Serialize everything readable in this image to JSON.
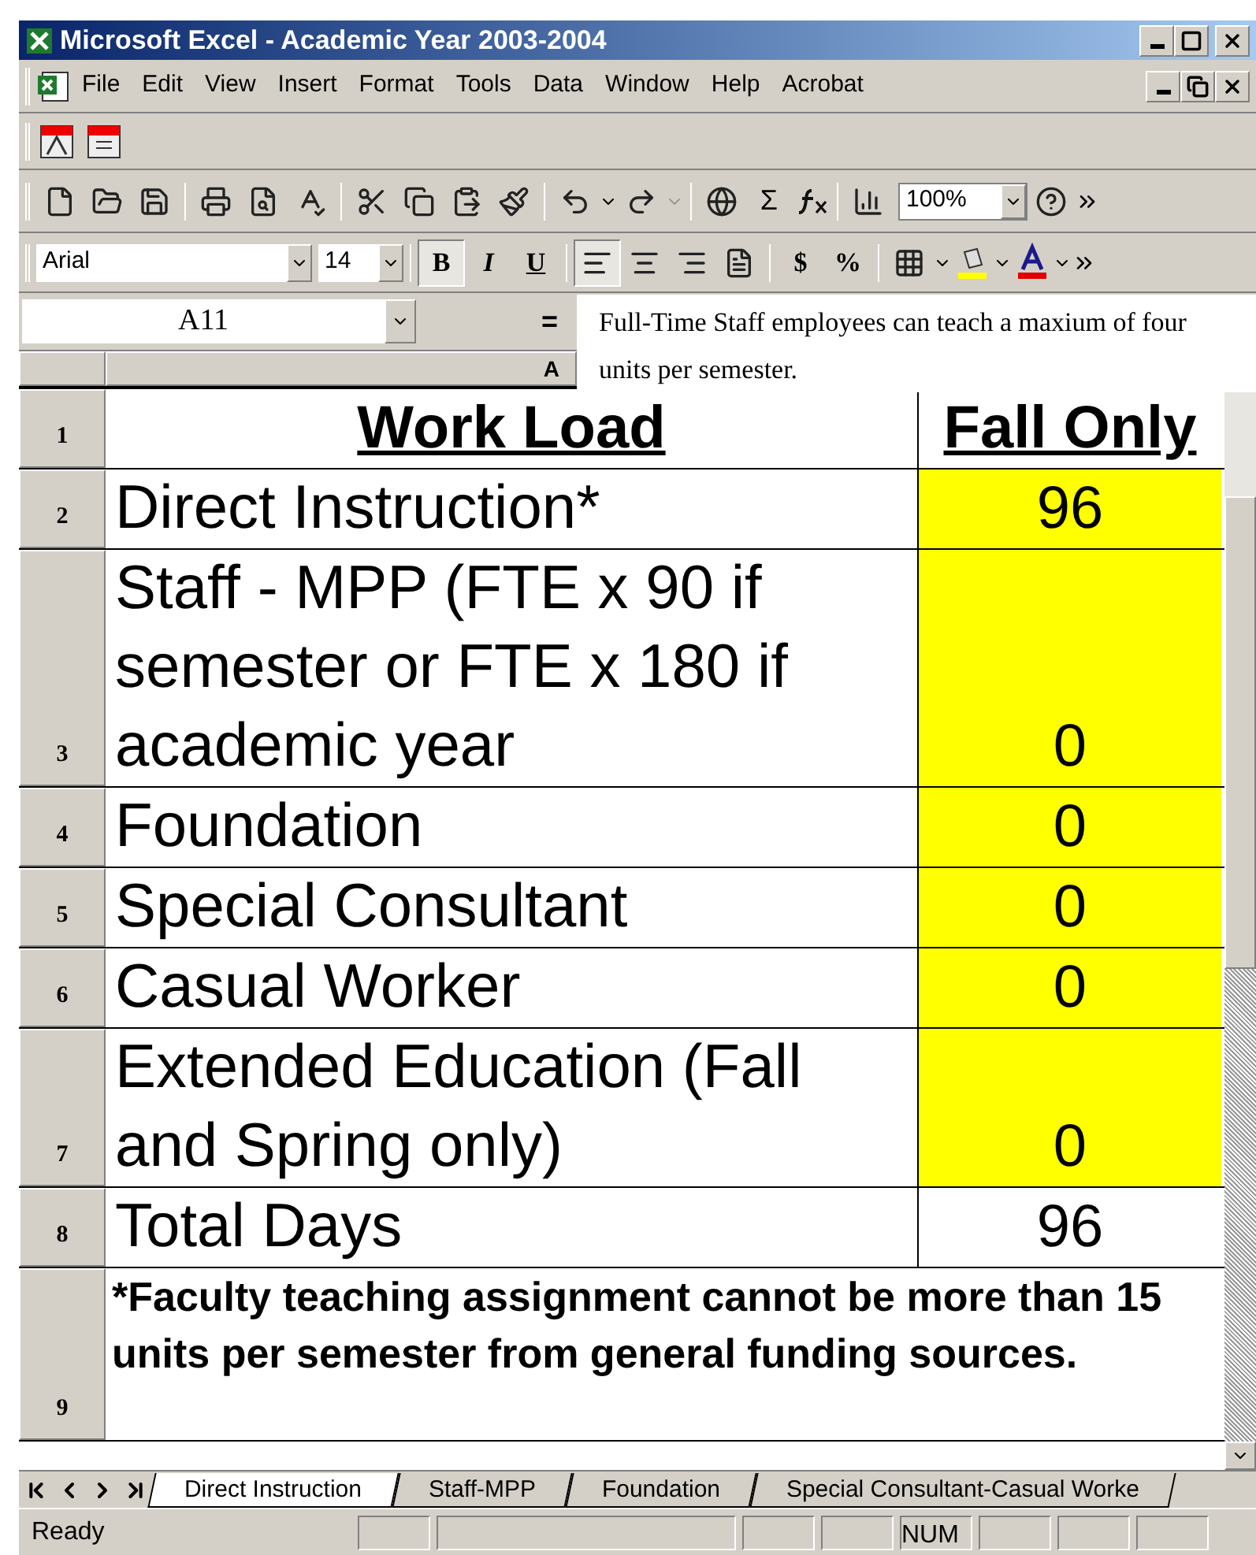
{
  "window": {
    "title": "Microsoft Excel - Academic Year 2003-2004"
  },
  "menu": [
    "File",
    "Edit",
    "View",
    "Insert",
    "Format",
    "Tools",
    "Data",
    "Window",
    "Help",
    "Acrobat"
  ],
  "standard_toolbar": {
    "autosum": "Σ",
    "zoom": "100%"
  },
  "formatting_toolbar": {
    "font": "Arial",
    "size": "14",
    "bold": {
      "label": "B",
      "pressed": true
    },
    "italic": {
      "label": "I",
      "pressed": false
    },
    "underline": {
      "label": "U",
      "pressed": false
    },
    "align_left_pressed": true,
    "currency": "$",
    "percent": "%"
  },
  "formula_bar": {
    "name_box": "A11",
    "equals": "="
  },
  "tooltip": "Full-Time Staff employees can teach a maxium of four units per semester.",
  "columns": [
    "A"
  ],
  "rows": [
    {
      "header": "1",
      "kind": "heading",
      "a": "Work Load",
      "b": "Fall Only"
    },
    {
      "header": "2",
      "kind": "data",
      "a": "Direct Instruction*",
      "b": "96",
      "highlighted": true
    },
    {
      "header": "3",
      "kind": "data",
      "a": "Staff - MPP (FTE x 90 if semester or FTE x 180 if academic year",
      "b": "0",
      "highlighted": true
    },
    {
      "header": "4",
      "kind": "data",
      "a": "Foundation",
      "b": "0",
      "highlighted": true
    },
    {
      "header": "5",
      "kind": "data",
      "a": "Special Consultant",
      "b": "0",
      "highlighted": true
    },
    {
      "header": "6",
      "kind": "data",
      "a": "Casual Worker",
      "b": "0",
      "highlighted": true
    },
    {
      "header": "7",
      "kind": "data",
      "a": "Extended Education (Fall and Spring only)",
      "b": "0",
      "highlighted": true
    },
    {
      "header": "8",
      "kind": "data",
      "a": "Total Days",
      "b": "96",
      "highlighted": false
    },
    {
      "header": "9",
      "kind": "note",
      "a": "*Faculty teaching assignment cannot be more than 15 units per semester from general funding sources."
    }
  ],
  "sheet_tabs": [
    {
      "label": "Direct Instruction",
      "selected": true
    },
    {
      "label": "Staff-MPP",
      "selected": false
    },
    {
      "label": "Foundation",
      "selected": false
    },
    {
      "label": "Special Consultant-Casual Worke",
      "selected": false
    }
  ],
  "status_bar": {
    "text": "Ready",
    "num_indicator": "NUM"
  }
}
